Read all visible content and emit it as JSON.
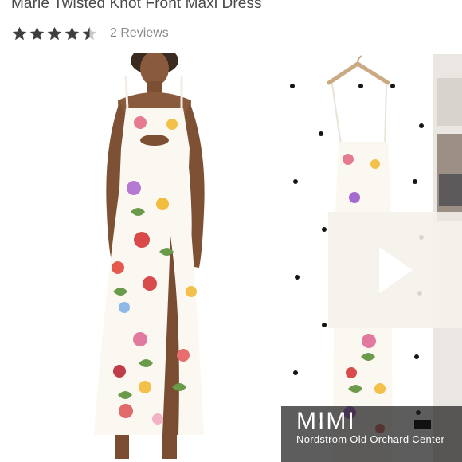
{
  "product": {
    "title": "Marie Twisted Knot Front Maxi Dress",
    "rating": {
      "value": 4.5,
      "max": 5,
      "reviews_label": "2 Reviews",
      "star_color": "#3f3f3f",
      "empty_star_color": "#c8c8c8"
    }
  },
  "gallery": {
    "main_photo": "model-wearing-floral-maxi-dress",
    "video_thumbnail": {
      "photo": "floral-dress-on-hanger",
      "play_icon": "play-icon",
      "caption_name": "MIMI",
      "caption_store": "Nordstrom Old Orchard Center"
    }
  },
  "colors": {
    "text": "#4a4a4a",
    "muted": "#8a8a8a",
    "overlay": "#f5f1ea"
  }
}
